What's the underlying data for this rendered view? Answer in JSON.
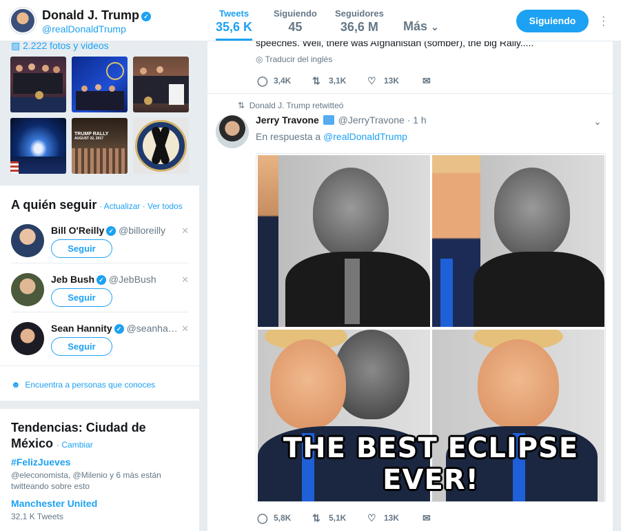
{
  "profile": {
    "name": "Donald J. Trump",
    "handle": "@realDonaldTrump",
    "stats": [
      {
        "label": "Tweets",
        "value": "35,6 K"
      },
      {
        "label": "Siguiendo",
        "value": "45"
      },
      {
        "label": "Seguidores",
        "value": "36,6 M"
      }
    ],
    "more_label": "Más",
    "following_label": "Siguiendo"
  },
  "photos": {
    "link": "2.222 fotos y videos",
    "thumbs": [
      "signing-photo",
      "stage-group-photo",
      "signing-with-document-photo",
      "stadium-lights-photo",
      "rally-photo",
      "seal-black-ribbon-photo"
    ],
    "thumb_lettering": {
      "rally": "TRUMP RALLY",
      "rally_date": "AUGUST 22, 2017"
    }
  },
  "who_to_follow": {
    "title": "A quién seguir",
    "refresh": "Actualizar",
    "view_all": "Ver todos",
    "users": [
      {
        "name": "Bill O'Reilly",
        "handle": "@billoreilly",
        "button": "Seguir"
      },
      {
        "name": "Jeb Bush",
        "handle": "@JebBush",
        "button": "Seguir"
      },
      {
        "name": "Sean Hannity",
        "handle": "@seanha…",
        "button": "Seguir"
      }
    ],
    "find_people": "Encuentra a personas que conoces"
  },
  "trends": {
    "title": "Tendencias: Ciudad de México",
    "change": "Cambiar",
    "items": [
      {
        "name": "#FelizJueves",
        "meta": "@eleconomista, @Milenio y 6 más están twitteando sobre esto"
      },
      {
        "name": "Manchester United",
        "meta": "32,1 K Tweets"
      }
    ]
  },
  "previous_tweet": {
    "text_fragment": "speeches. Well, there was Afghanistan (somber), the big Rally.....",
    "translate": "Traducir del inglés",
    "replies": "3,4K",
    "retweets": "3,1K",
    "likes": "13K"
  },
  "tweet": {
    "retweet_context": "Donald J. Trump retwitteó",
    "name": "Jerry Travone",
    "handle": "@JerryTravone",
    "time": "· 1 h",
    "reply_prefix": "En respuesta a",
    "reply_handle": "@realDonaldTrump",
    "image_caption": "THE BEST ECLIPSE EVER!",
    "replies": "5,8K",
    "retweets": "5,1K",
    "likes": "13K"
  },
  "colors": {
    "accent": "#1da1f2",
    "background": "#e6ecf0",
    "muted": "#657786"
  }
}
